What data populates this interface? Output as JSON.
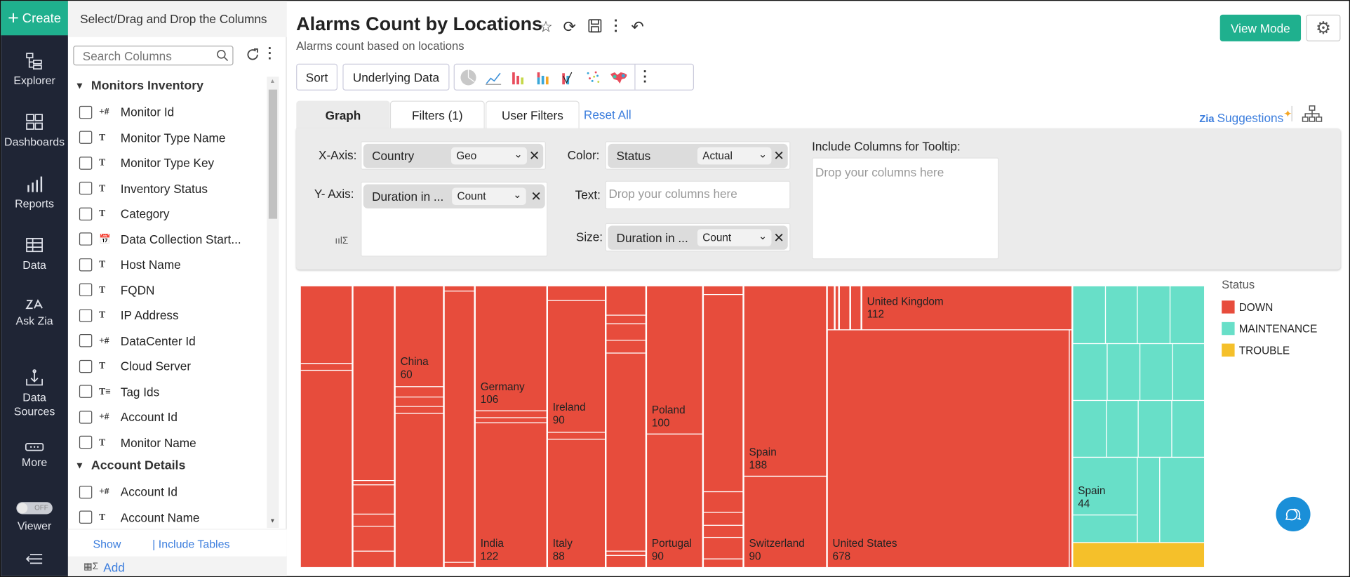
{
  "nav": {
    "create": "Create",
    "items": [
      {
        "label": "Explorer",
        "icon": "explorer-icon"
      },
      {
        "label": "Dashboards",
        "icon": "dashboards-icon"
      },
      {
        "label": "Reports",
        "icon": "reports-icon"
      },
      {
        "label": "Data",
        "icon": "table-icon"
      },
      {
        "label": "Ask Zia",
        "icon": "zia-icon"
      },
      {
        "label": "Data Sources",
        "icon": "data-sources-icon"
      },
      {
        "label": "More",
        "icon": "more-icon"
      }
    ],
    "viewer_toggle": "OFF",
    "viewer_label": "Viewer"
  },
  "panel": {
    "header": "Select/Drag and Drop the Columns",
    "search_placeholder": "Search Columns",
    "groups": [
      {
        "name": "Monitors Inventory",
        "columns": [
          {
            "label": "Monitor Id",
            "type": "+#"
          },
          {
            "label": "Monitor Type Name",
            "type": "T"
          },
          {
            "label": "Monitor Type Key",
            "type": "T"
          },
          {
            "label": "Inventory Status",
            "type": "T"
          },
          {
            "label": "Category",
            "type": "T"
          },
          {
            "label": "Data Collection Start...",
            "type": "date"
          },
          {
            "label": "Host Name",
            "type": "T"
          },
          {
            "label": "FQDN",
            "type": "T"
          },
          {
            "label": "IP Address",
            "type": "T"
          },
          {
            "label": "DataCenter Id",
            "type": "+#"
          },
          {
            "label": "Cloud Server",
            "type": "T"
          },
          {
            "label": "Tag Ids",
            "type": "T≡"
          },
          {
            "label": "Account Id",
            "type": "+#"
          },
          {
            "label": "Monitor Name",
            "type": "T"
          }
        ]
      },
      {
        "name": "Account Details",
        "columns": [
          {
            "label": "Account Id",
            "type": "+#"
          },
          {
            "label": "Account Name",
            "type": "T"
          }
        ]
      }
    ],
    "show": "Show",
    "include_tables": "| Include Tables",
    "add": "Add"
  },
  "header": {
    "title": "Alarms Count by Locations",
    "subtitle": "Alarms count based on locations",
    "view_mode": "View Mode"
  },
  "toolbar": {
    "sort": "Sort",
    "underlying_data": "Underlying Data"
  },
  "tabs": {
    "graph": "Graph",
    "filters": "Filters  (1)",
    "user_filters": "User Filters",
    "reset_all": "Reset All",
    "suggestions": "Suggestions"
  },
  "config": {
    "x_axis": {
      "label": "X-Axis:",
      "column": "Country",
      "function": "Geo"
    },
    "y_axis": {
      "label": "Y- Axis:",
      "column": "Duration in ...",
      "function": "Count"
    },
    "color": {
      "label": "Color:",
      "column": "Status",
      "function": "Actual"
    },
    "text": {
      "label": "Text:",
      "placeholder": "Drop your columns here"
    },
    "size": {
      "label": "Size:",
      "column": "Duration in ...",
      "function": "Count"
    },
    "tooltip": {
      "label": "Include Columns for Tooltip:",
      "placeholder": "Drop your columns here"
    }
  },
  "chart_data": {
    "type": "treemap",
    "legend": {
      "title": "Status",
      "position": "right",
      "items": [
        {
          "name": "DOWN",
          "color": "#e74c3c"
        },
        {
          "name": "MAINTENANCE",
          "color": "#68dfc8"
        },
        {
          "name": "TROUBLE",
          "color": "#f5c02a"
        }
      ]
    },
    "labeled_cells": [
      {
        "country": "China",
        "status": "DOWN",
        "value": 60
      },
      {
        "country": "Germany",
        "status": "DOWN",
        "value": 106
      },
      {
        "country": "India",
        "status": "DOWN",
        "value": 122
      },
      {
        "country": "Ireland",
        "status": "DOWN",
        "value": 90
      },
      {
        "country": "Italy",
        "status": "DOWN",
        "value": 88
      },
      {
        "country": "Poland",
        "status": "DOWN",
        "value": 100
      },
      {
        "country": "Portugal",
        "status": "DOWN",
        "value": 90
      },
      {
        "country": "Spain",
        "status": "DOWN",
        "value": 188
      },
      {
        "country": "Switzerland",
        "status": "DOWN",
        "value": 90
      },
      {
        "country": "United Kingdom",
        "status": "DOWN",
        "value": 112
      },
      {
        "country": "United States",
        "status": "DOWN",
        "value": 678
      },
      {
        "country": "Spain",
        "status": "MAINTENANCE",
        "value": 44
      }
    ]
  }
}
